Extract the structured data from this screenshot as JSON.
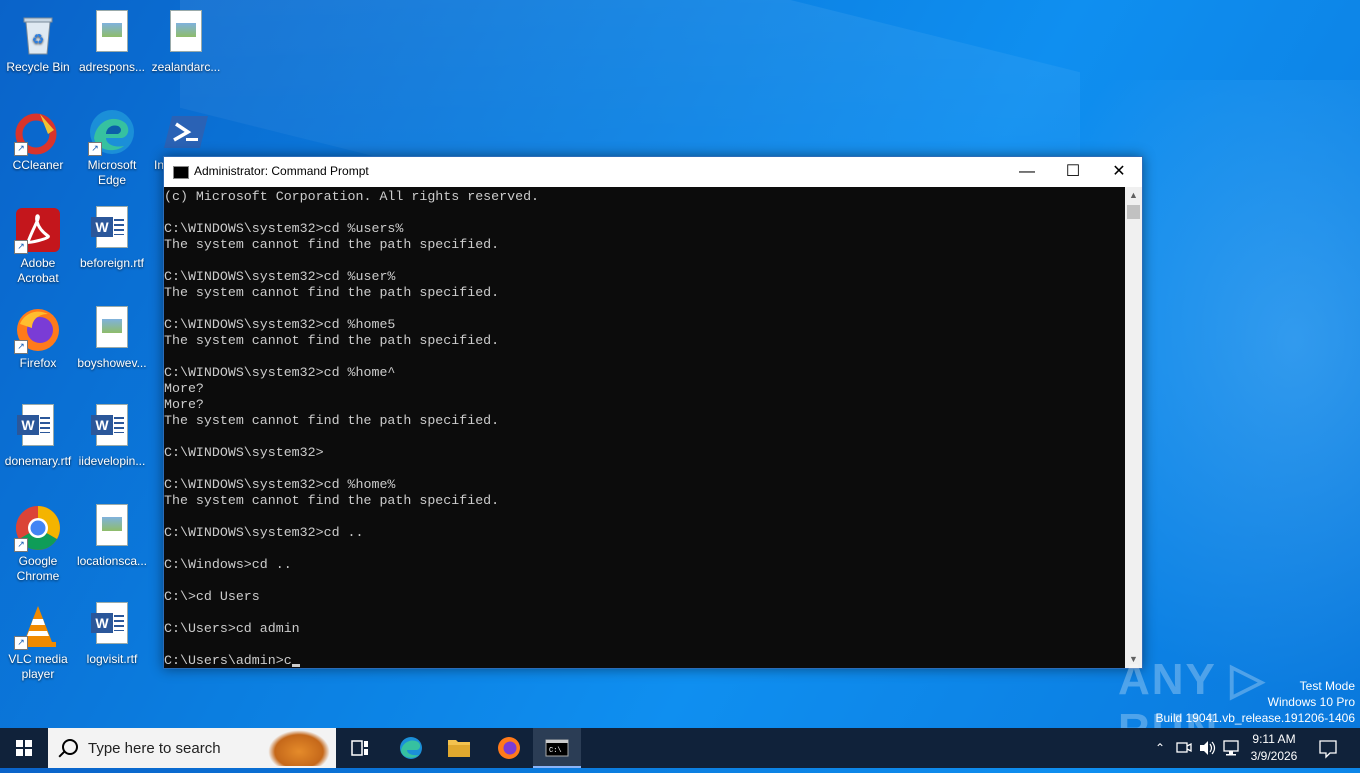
{
  "desktop": {
    "icons": [
      {
        "label": "Recycle Bin"
      },
      {
        "label": "adrespons..."
      },
      {
        "label": "zealandarc..."
      },
      {
        "label": "CCleaner"
      },
      {
        "label": "Microsoft Edge"
      },
      {
        "label": "In"
      },
      {
        "label": "Adobe Acrobat"
      },
      {
        "label": "beforeign.rtf"
      },
      {
        "label": "Firefox"
      },
      {
        "label": "boyshowev..."
      },
      {
        "label": "donemary.rtf"
      },
      {
        "label": "iidevelopin..."
      },
      {
        "label": "Google Chrome"
      },
      {
        "label": "locationsca..."
      },
      {
        "label": "VLC media player"
      },
      {
        "label": "logvisit.rtf"
      }
    ]
  },
  "window": {
    "title": "Administrator: Command Prompt",
    "minimize": "—",
    "maximize": "☐",
    "close": "✕",
    "console_text": "(c) Microsoft Corporation. All rights reserved.\n\nC:\\WINDOWS\\system32>cd %users%\nThe system cannot find the path specified.\n\nC:\\WINDOWS\\system32>cd %user%\nThe system cannot find the path specified.\n\nC:\\WINDOWS\\system32>cd %home5\nThe system cannot find the path specified.\n\nC:\\WINDOWS\\system32>cd %home^\nMore?\nMore?\nThe system cannot find the path specified.\n\nC:\\WINDOWS\\system32>\n\nC:\\WINDOWS\\system32>cd %home%\nThe system cannot find the path specified.\n\nC:\\WINDOWS\\system32>cd ..\n\nC:\\Windows>cd ..\n\nC:\\>cd Users\n\nC:\\Users>cd admin\n\n",
    "current_line": "C:\\Users\\admin>c"
  },
  "watermark": {
    "logo_text": "ANY ▷ RUN",
    "test_mode": "Test Mode",
    "edition": "Windows 10 Pro",
    "build": "Build 19041.vb_release.191206-1406"
  },
  "taskbar": {
    "search_placeholder": "Type here to search",
    "time": "9:11 AM",
    "date": "3/9/2026"
  }
}
